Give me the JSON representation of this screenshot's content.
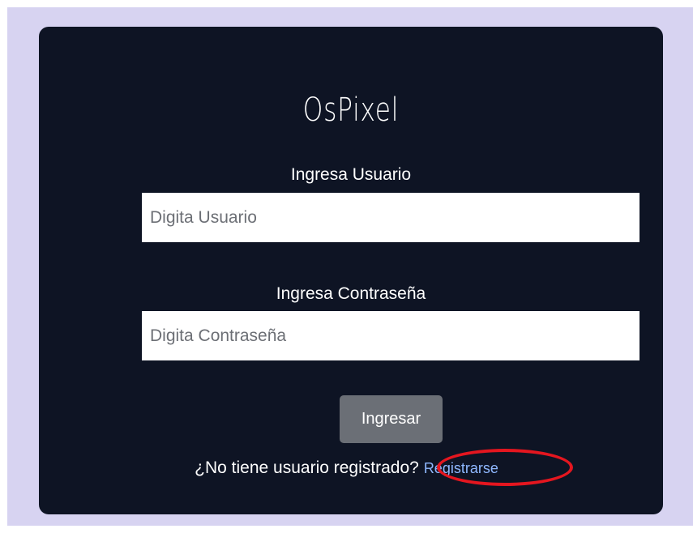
{
  "login": {
    "brand": "OsPixel",
    "user_label": "Ingresa Usuario",
    "user_placeholder": "Digita Usuario",
    "password_label": "Ingresa Contraseña",
    "password_placeholder": "Digita Contraseña",
    "submit_label": "Ingresar",
    "register_prompt": "¿No tiene usuario registrado?",
    "register_link": "Registrarse"
  },
  "colors": {
    "page_background": "#d7d3f1",
    "card_background": "#0e1424",
    "button_background": "#6b6f76",
    "link": "#8fb8ff",
    "annotation_oval": "#e4161f"
  }
}
